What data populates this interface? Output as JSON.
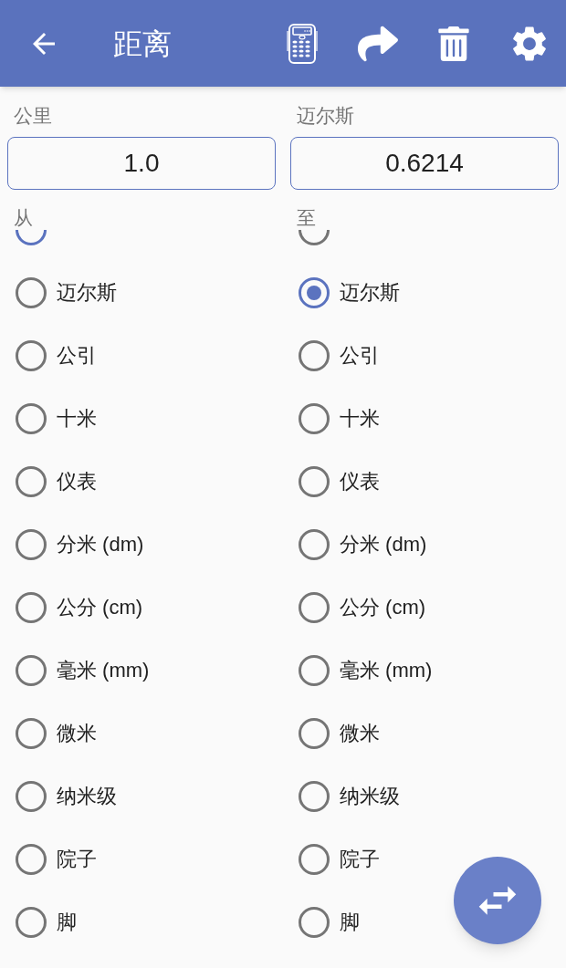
{
  "app_bar": {
    "title": "距离"
  },
  "panels": [
    {
      "unit_label": "公里",
      "value": "1.0",
      "list_label": "从",
      "items": [
        {
          "selected": true
        },
        {
          "label": "迈尔斯",
          "selected": false
        },
        {
          "label": "公引",
          "selected": false
        },
        {
          "label": "十米",
          "selected": false
        },
        {
          "label": "仪表",
          "selected": false
        },
        {
          "label": "分米 (dm)",
          "selected": false
        },
        {
          "label": "公分 (cm)",
          "selected": false
        },
        {
          "label": "毫米 (mm)",
          "selected": false
        },
        {
          "label": "微米",
          "selected": false
        },
        {
          "label": "纳米级",
          "selected": false
        },
        {
          "label": "院子",
          "selected": false
        },
        {
          "label": "脚",
          "selected": false
        }
      ]
    },
    {
      "unit_label": "迈尔斯",
      "value": "0.6214",
      "list_label": "至",
      "items": [
        {
          "selected": false
        },
        {
          "label": "迈尔斯",
          "selected": true
        },
        {
          "label": "公引",
          "selected": false
        },
        {
          "label": "十米",
          "selected": false
        },
        {
          "label": "仪表",
          "selected": false
        },
        {
          "label": "分米 (dm)",
          "selected": false
        },
        {
          "label": "公分 (cm)",
          "selected": false
        },
        {
          "label": "毫米 (mm)",
          "selected": false
        },
        {
          "label": "微米",
          "selected": false
        },
        {
          "label": "纳米级",
          "selected": false
        },
        {
          "label": "院子",
          "selected": false
        },
        {
          "label": "脚",
          "selected": false
        }
      ]
    }
  ]
}
